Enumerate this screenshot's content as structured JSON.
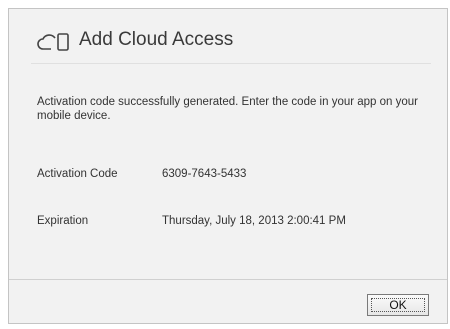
{
  "dialog": {
    "title": "Add Cloud Access",
    "header_icon": "cloud-device-icon",
    "message": "Activation code successfully generated. Enter the code in your app on your mobile device.",
    "activation_code_label": "Activation Code",
    "activation_code_value": "6309-7643-5433",
    "expiration_label": "Expiration",
    "expiration_value": "Thursday, July 18, 2013 2:00:41 PM",
    "ok_label": "OK"
  }
}
